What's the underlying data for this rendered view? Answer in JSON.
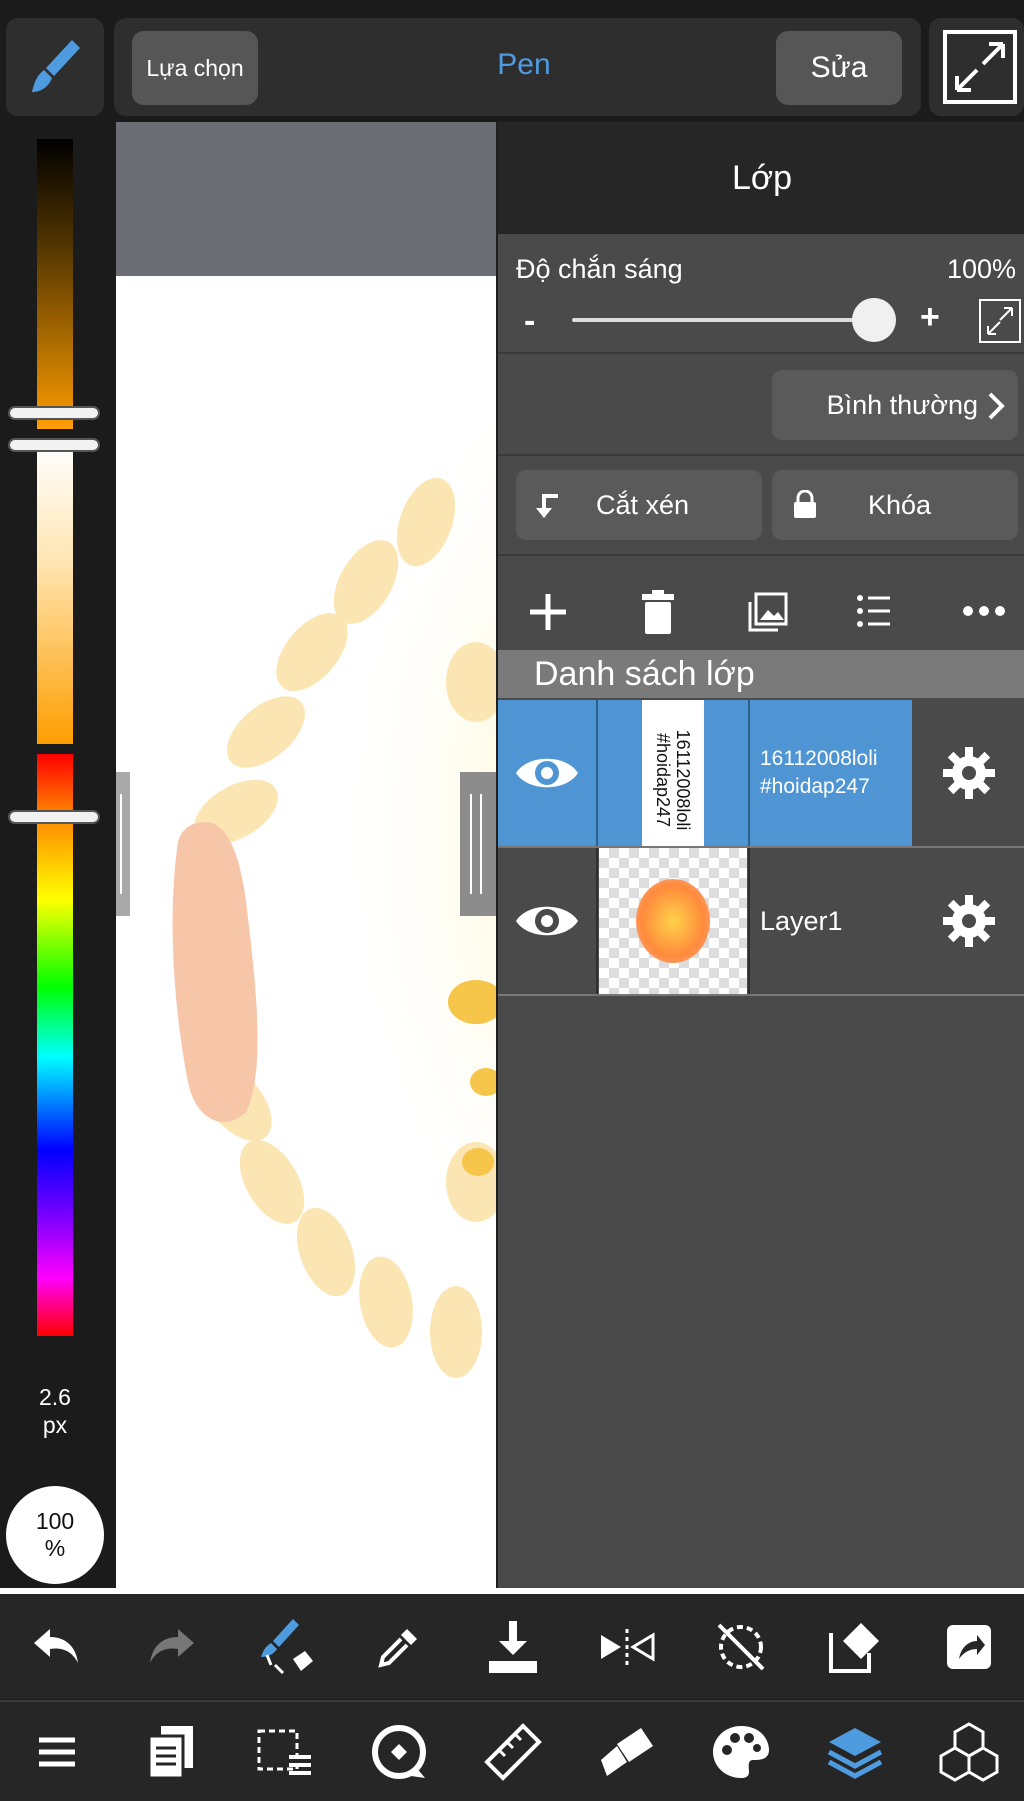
{
  "toolbar": {
    "select_label": "Lựa chọn",
    "tool_name": "Pen",
    "edit_label": "Sửa",
    "brush_icon": "brush-icon",
    "expand_icon": "expand-icon"
  },
  "brush": {
    "size_value": "2.6",
    "size_unit": "px",
    "opacity_value": "100",
    "opacity_unit": "%"
  },
  "panel": {
    "title": "Lớp",
    "opacity_label": "Độ chắn sáng",
    "opacity_value": "100%",
    "opacity_level": 1.0,
    "minus_label": "-",
    "plus_label": "+",
    "blend_mode": "Bình thường",
    "clip_label": "Cắt xén",
    "lock_label": "Khóa",
    "list_header": "Danh sách lớp",
    "actions": [
      "plus-icon",
      "trash-icon",
      "image-layer-icon",
      "list-icon",
      "more-icon"
    ]
  },
  "layers": [
    {
      "name_line1": "16112008loli",
      "name_line2": "#hoidap247",
      "thumb_text": "16112008loli #hoidap247",
      "selected": true
    },
    {
      "name_line1": "Layer1",
      "name_line2": "",
      "selected": false
    }
  ],
  "bottom_toolbar_1": [
    "undo-icon",
    "redo-icon",
    "transform-brush-icon",
    "eyedropper-icon",
    "save-icon",
    "flip-icon",
    "rotate-off-icon",
    "eraser-edit-icon",
    "share-icon"
  ],
  "bottom_toolbar_2": [
    "menu-icon",
    "pages-icon",
    "selection-icon",
    "rotate-canvas-icon",
    "ruler-icon",
    "fill-icon",
    "palette-icon",
    "layers-icon",
    "3d-icon"
  ],
  "colors": {
    "accent": "#4e9be0",
    "selected_layer": "#4f95d3",
    "panel_bg": "#4a4a4a",
    "toolbar_bg": "#262626"
  }
}
